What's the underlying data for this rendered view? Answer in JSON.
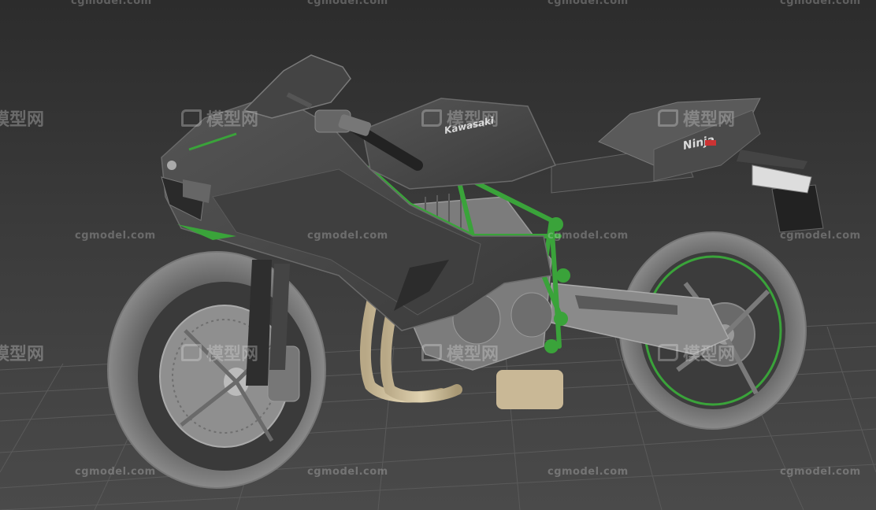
{
  "viewport": {
    "background_top": "#2c2c2c",
    "background_bottom": "#4a4a4a",
    "grid_color": "#5a5a5a"
  },
  "model": {
    "brand_logo": "Kawasaki",
    "tail_badge": "Ninja",
    "frame_color": "#3aa33a",
    "body_color": "#4a4a4a",
    "exhaust_color": "#c9b896"
  },
  "watermarks": {
    "site": "cgmodel.com",
    "cn": "模型网"
  }
}
